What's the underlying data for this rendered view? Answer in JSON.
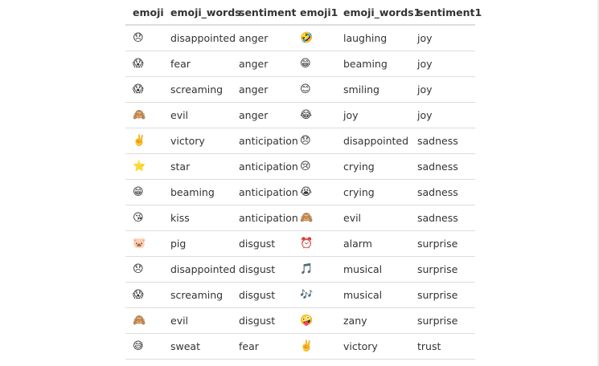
{
  "table": {
    "columns": [
      "emoji",
      "emoji_words",
      "sentiment",
      "emoji1",
      "emoji_words1",
      "sentiment1"
    ],
    "rows": [
      [
        "😞",
        "disappointed",
        "anger",
        "🤣",
        "laughing",
        "joy"
      ],
      [
        "😱",
        "fear",
        "anger",
        "😁",
        "beaming",
        "joy"
      ],
      [
        "😱",
        "screaming",
        "anger",
        "😊",
        "smiling",
        "joy"
      ],
      [
        "🙈",
        "evil",
        "anger",
        "😂",
        "joy",
        "joy"
      ],
      [
        "✌️",
        "victory",
        "anticipation",
        "😞",
        "disappointed",
        "sadness"
      ],
      [
        "⭐",
        "star",
        "anticipation",
        "😢",
        "crying",
        "sadness"
      ],
      [
        "😁",
        "beaming",
        "anticipation",
        "😭",
        "crying",
        "sadness"
      ],
      [
        "😘",
        "kiss",
        "anticipation",
        "🙈",
        "evil",
        "sadness"
      ],
      [
        "🐷",
        "pig",
        "disgust",
        "⏰",
        "alarm",
        "surprise"
      ],
      [
        "😞",
        "disappointed",
        "disgust",
        "🎵",
        "musical",
        "surprise"
      ],
      [
        "😱",
        "screaming",
        "disgust",
        "🎶",
        "musical",
        "surprise"
      ],
      [
        "🙈",
        "evil",
        "disgust",
        "🤪",
        "zany",
        "surprise"
      ],
      [
        "😅",
        "sweat",
        "fear",
        "✌️",
        "victory",
        "trust"
      ]
    ]
  }
}
